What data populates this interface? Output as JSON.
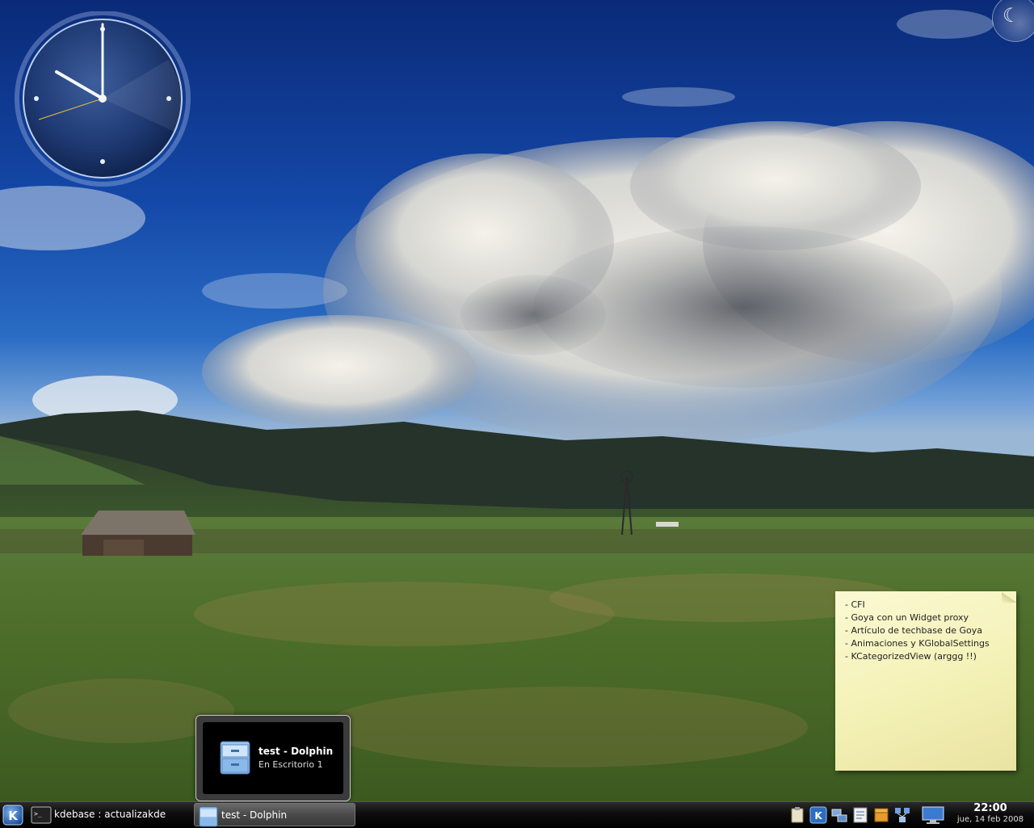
{
  "desktop": {
    "clock_widget": {
      "hour": 22,
      "minute": 0
    },
    "note": {
      "lines": [
        "- CFI",
        "- Goya con un Widget proxy",
        "- Artículo de techbase de Goya",
        "- Animaciones y KGlobalSettings",
        "- KCategorizedView (arggg !!)"
      ]
    },
    "tooltip": {
      "title": "test - Dolphin",
      "subtitle": "En Escritorio 1",
      "icon": "dolphin-folder-icon"
    }
  },
  "panel": {
    "launcher_icon": "kde-logo-icon",
    "tasks": [
      {
        "label": "kdebase : actualizakde",
        "icon": "terminal-icon",
        "active": false
      },
      {
        "label": "test - Dolphin",
        "icon": "dolphin-folder-icon",
        "active": true
      }
    ],
    "tray_icons": [
      "clipboard-icon",
      "kde-updates-icon",
      "network-icon",
      "notes-icon",
      "package-icon",
      "network-manager-icon"
    ],
    "show_desktop_icon": "show-desktop-icon",
    "clock": {
      "time": "22:00",
      "date": "jue, 14 feb 2008"
    }
  },
  "colors": {
    "panel_bg": "#000000",
    "note_bg": "#f4f1b6",
    "tooltip_border": "#c8c8c8"
  }
}
